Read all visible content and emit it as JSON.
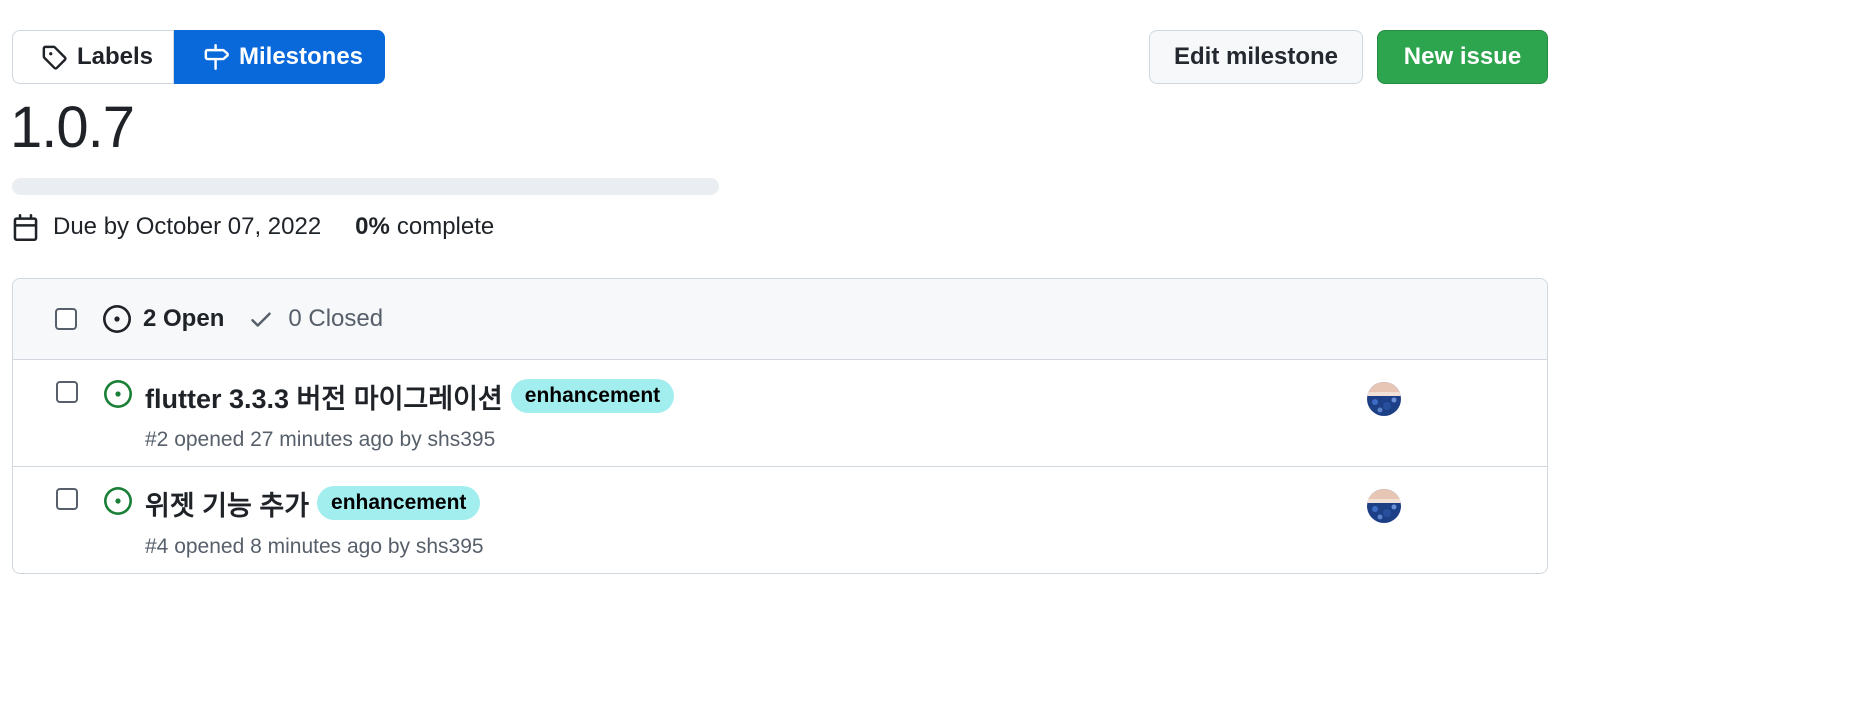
{
  "subnav": {
    "labels_label": "Labels",
    "milestones_label": "Milestones"
  },
  "actions": {
    "edit_label": "Edit milestone",
    "new_issue_label": "New issue"
  },
  "milestone": {
    "title": "1.0.7",
    "progress_fraction": 0,
    "due_text": "Due by October 07, 2022",
    "percent": "0%",
    "complete_text": "complete"
  },
  "issues_header": {
    "open_text": "2 Open",
    "closed_text": "0 Closed"
  },
  "issues": [
    {
      "title": "flutter 3.3.3 버전 마이그레이션",
      "label": "enhancement",
      "meta": "#2 opened 27 minutes ago by shs395"
    },
    {
      "title": "위젯 기능 추가",
      "label": "enhancement",
      "meta": "#4 opened 8 minutes ago by shs395"
    }
  ],
  "colors": {
    "accent": "#0969da",
    "success": "#2da44e",
    "open_icon": "#1a7f37",
    "label_bg": "#a2eeef"
  },
  "icons": [
    "tag-icon",
    "milestone-icon",
    "calendar-icon",
    "issue-opened-icon",
    "check-icon"
  ]
}
